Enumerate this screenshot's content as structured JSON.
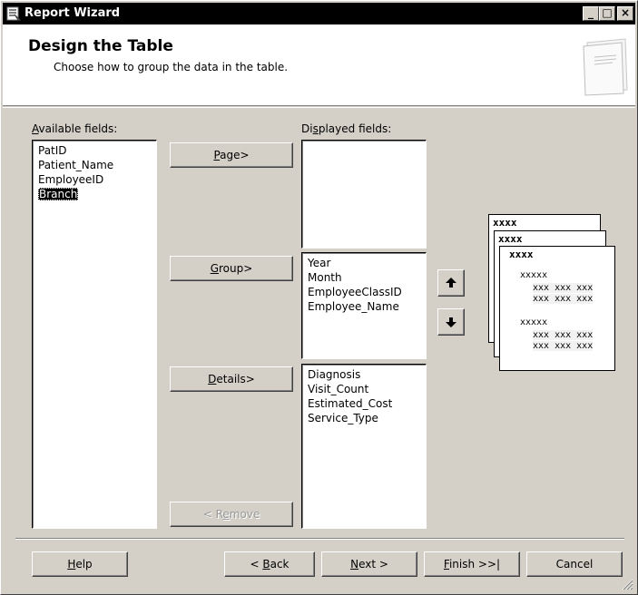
{
  "window": {
    "title": "Report Wizard",
    "icon": "report-wizard-icon"
  },
  "titlebar_buttons": {
    "minimize": "_",
    "maximize": "□",
    "close": "×"
  },
  "header": {
    "title": "Design the Table",
    "subtitle": "Choose how to group the data in the table."
  },
  "available": {
    "label_mnemonic": "A",
    "label_rest": "vailable fields:",
    "items": [
      "PatID",
      "Patient_Name",
      "EmployeeID",
      "Branch"
    ],
    "selected": "Branch"
  },
  "displayed": {
    "label_pre": "Di",
    "label_mnemonic": "s",
    "label_rest": "played fields:"
  },
  "page_list": {
    "items": []
  },
  "group_list": {
    "items": [
      "Year",
      "Month",
      "EmployeeClassID",
      "Employee_Name"
    ]
  },
  "details_list": {
    "items": [
      "Diagnosis",
      "Visit_Count",
      "Estimated_Cost",
      "Service_Type"
    ]
  },
  "buttons": {
    "page": {
      "mnemonic": "P",
      "rest": "age>"
    },
    "group": {
      "mnemonic": "G",
      "rest": "roup>"
    },
    "details": {
      "mnemonic": "D",
      "rest": "etails>"
    },
    "remove": {
      "pre": "< R",
      "mnemonic": "e",
      "rest": "move"
    },
    "help": {
      "mnemonic": "H",
      "rest": "elp"
    },
    "back": {
      "pre": "< ",
      "mnemonic": "B",
      "rest": "ack"
    },
    "next": {
      "mnemonic": "N",
      "rest": "ext >"
    },
    "finish": {
      "mnemonic": "F",
      "rest": "inish >>|"
    },
    "cancel": "Cancel"
  },
  "preview": {
    "header1": "xxxx",
    "header2": "xxxx",
    "header3": "xxxx",
    "group_label": "xxxxx",
    "row": "xxx xxx xxx"
  }
}
